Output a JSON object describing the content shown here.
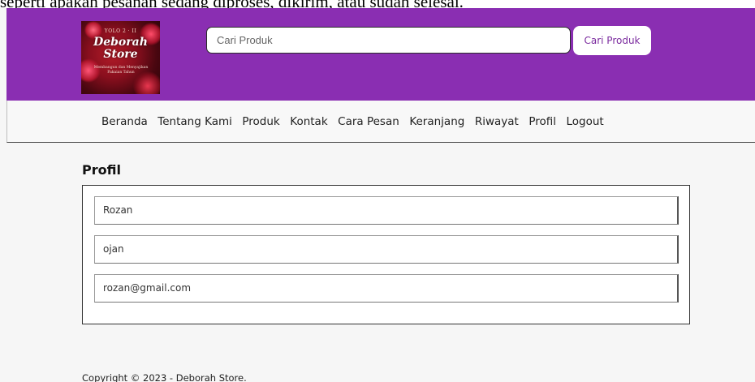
{
  "page": {
    "caption": "seperti apakah pesanan sedang diproses, dikirim, atau sudah selesai."
  },
  "colors": {
    "header_bg": "#8a2eb2",
    "accent_text": "#7a2a9e",
    "page_bg": "#f6f6f6"
  },
  "header": {
    "logo": {
      "tagline": "YOLO 2 · II",
      "name_line1": "Deborah",
      "name_line2": "Store",
      "slogan": "Membangun dan Menyajikan Pakaian Tahun"
    },
    "search": {
      "placeholder": "Cari Produk",
      "value": "",
      "button_label": "Cari Produk"
    }
  },
  "nav": {
    "items": [
      {
        "label": "Beranda"
      },
      {
        "label": "Tentang Kami"
      },
      {
        "label": "Produk"
      },
      {
        "label": "Kontak"
      },
      {
        "label": "Cara Pesan"
      },
      {
        "label": "Keranjang"
      },
      {
        "label": "Riwayat"
      },
      {
        "label": "Profil"
      },
      {
        "label": "Logout"
      }
    ]
  },
  "main": {
    "title": "Profil",
    "fields": [
      {
        "value": "Rozan"
      },
      {
        "value": "ojan"
      },
      {
        "value": "rozan@gmail.com"
      }
    ]
  },
  "footer": {
    "copyright": "Copyright © 2023 - Deborah Store."
  }
}
